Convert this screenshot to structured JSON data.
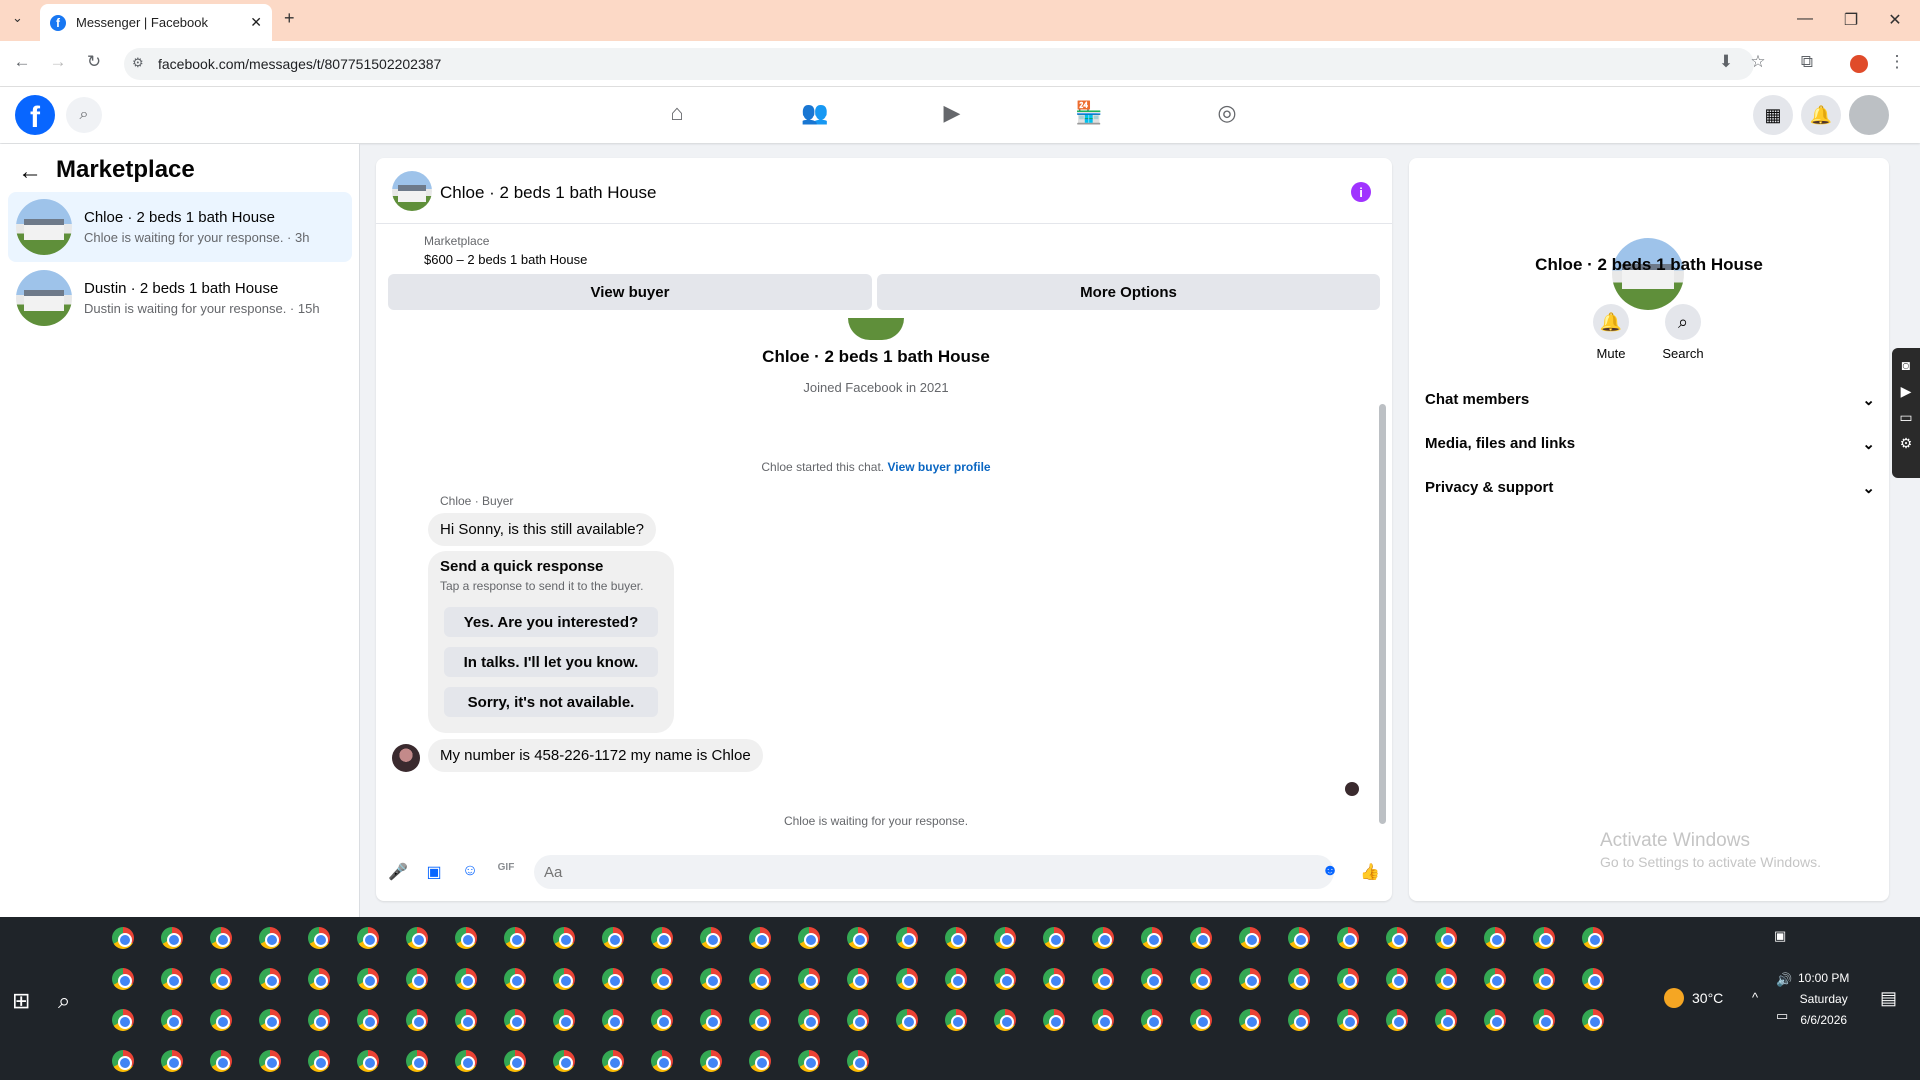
{
  "browser": {
    "tab_title": "Messenger | Facebook",
    "url": "facebook.com/messages/t/807751502202387"
  },
  "sidebar": {
    "title": "Marketplace",
    "conversations": [
      {
        "title": "Chloe · 2 beds 1 bath House",
        "subtitle": "Chloe is waiting for your response. · 3h",
        "active": true
      },
      {
        "title": "Dustin · 2 beds 1 bath House",
        "subtitle": "Dustin is waiting for your response. · 15h",
        "active": false
      }
    ]
  },
  "chat": {
    "title": "Chloe · 2 beds 1 bath House",
    "listing_label": "Marketplace",
    "listing_price": "$600 – 2 beds 1 bath House",
    "view_buyer": "View buyer",
    "more_options": "More Options",
    "profile_name": "Chloe · 2 beds 1 bath House",
    "profile_sub": "Joined Facebook in 2021",
    "started_text": "Chloe started this chat.",
    "view_profile": "View buyer profile",
    "sender_label": "Chloe · Buyer",
    "message1": "Hi Sonny, is this still available?",
    "quick_title": "Send a quick response",
    "quick_sub": "Tap a response to send it to the buyer.",
    "quick_replies": [
      "Yes. Are you interested?",
      "In talks. I'll let you know.",
      "Sorry, it's not available."
    ],
    "message2": "My number is 458-226-1172 my name is Chloe",
    "waiting": "Chloe is waiting for your response.",
    "input_placeholder": "Aa"
  },
  "details": {
    "title": "Chloe · 2 beds 1 bath House",
    "mute": "Mute",
    "search": "Search",
    "sections": [
      "Chat members",
      "Media, files and links",
      "Privacy & support"
    ]
  },
  "watermark": {
    "line1": "Activate Windows",
    "line2": "Go to Settings to activate Windows."
  },
  "taskbar": {
    "temperature": "30°C",
    "time": "10:00 PM",
    "day": "Saturday",
    "date": "6/6/2026"
  },
  "colors": {
    "brand": "#0866ff",
    "tab_strip": "#fcd9c6",
    "info_icon": "#a033ff",
    "taskbar": "#1f2429"
  },
  "icons": [
    "facebook-logo",
    "search-icon",
    "home-icon",
    "friends-icon",
    "video-icon",
    "marketplace-icon",
    "groups-icon",
    "apps-grid-icon",
    "bell-icon",
    "avatar",
    "info-icon",
    "mic-icon",
    "image-icon",
    "sticker-icon",
    "gif-icon",
    "emoji-icon",
    "like-icon"
  ]
}
